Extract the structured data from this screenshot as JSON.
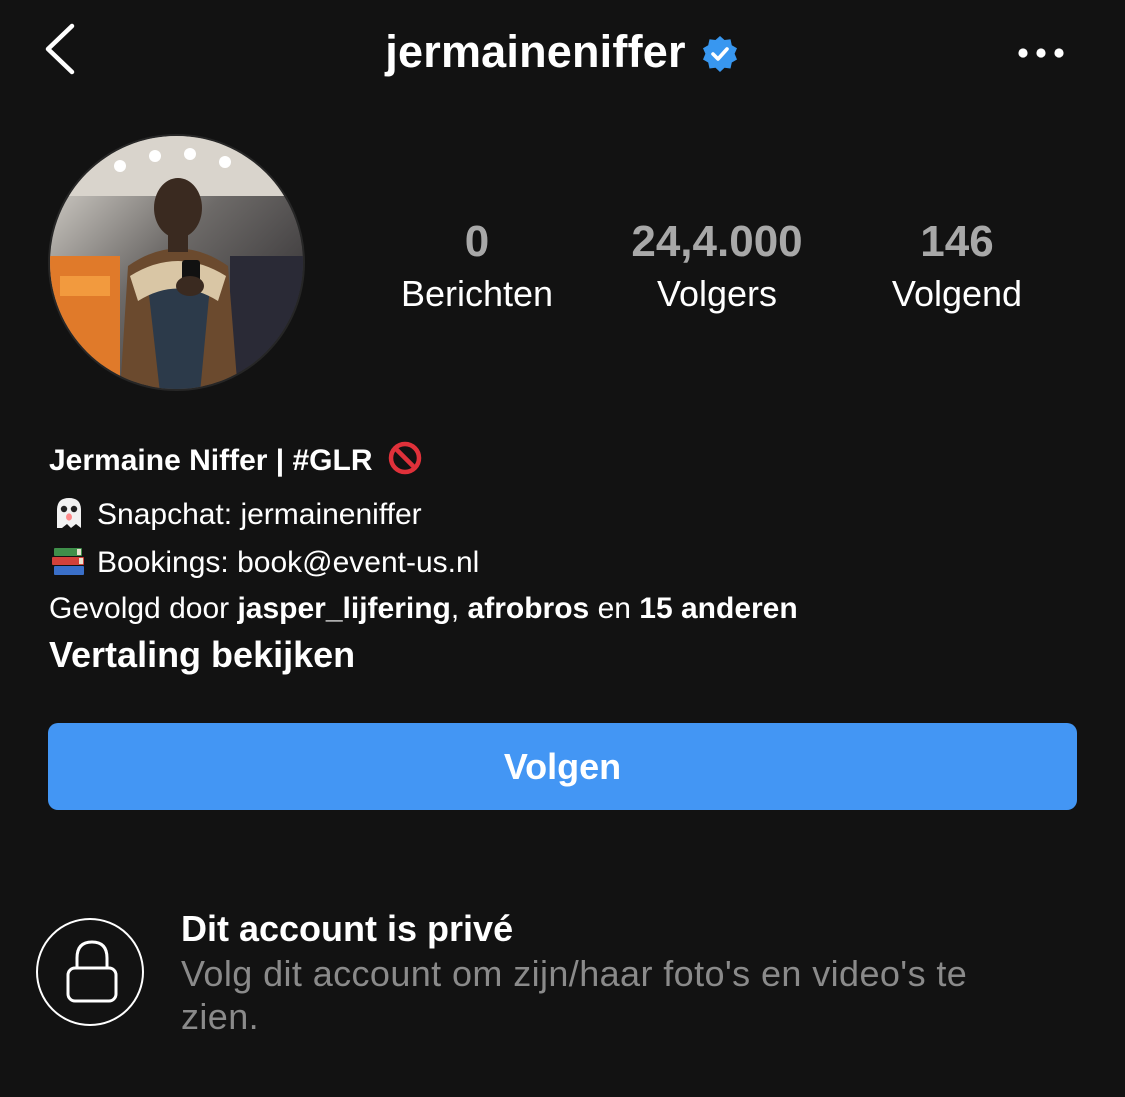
{
  "header": {
    "username": "jermaineniffer",
    "icons": {
      "back": "chevron-left-icon",
      "verified": "verified-badge-icon",
      "more": "more-dots-icon"
    }
  },
  "colors": {
    "background": "#121212",
    "accent": "#4396f4",
    "verified": "#3897f0",
    "muted": "#a8a8a8"
  },
  "stats": [
    {
      "value": "0",
      "label": "Berichten"
    },
    {
      "value": "24,4.000",
      "label": "Volgers"
    },
    {
      "value": "146",
      "label": "Volgend"
    }
  ],
  "bio": {
    "name": "Jermaine Niffer | #GLR",
    "name_icon": "prohibited-icon",
    "snapchat": "Snapchat: jermaineniffer",
    "snapchat_icon": "ghost-icon",
    "bookings": "Bookings: book@event-us.nl",
    "bookings_icon": "books-icon",
    "followed_by_prefix": "Gevolgd door ",
    "followed_by_user1": "jasper_lijfering",
    "followed_by_sep": ", ",
    "followed_by_user2": "afrobros",
    "followed_by_mid": " en ",
    "followed_by_rest": "15 anderen",
    "translate": "Vertaling bekijken"
  },
  "follow_button": {
    "label": "Volgen"
  },
  "private": {
    "icon": "lock-icon",
    "title": "Dit account is privé",
    "text": "Volg dit account om zijn/haar foto's en video's te zien."
  }
}
